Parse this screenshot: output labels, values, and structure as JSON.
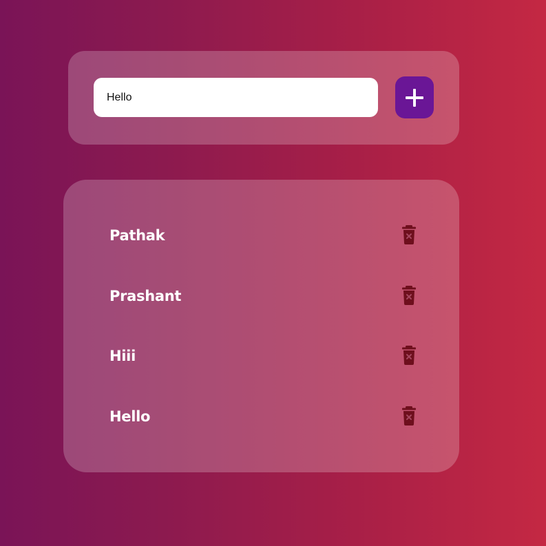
{
  "input": {
    "value": "Hello",
    "add_icon": "plus-icon"
  },
  "todos": [
    {
      "label": "Pathak",
      "delete_icon": "trash-icon"
    },
    {
      "label": "Prashant",
      "delete_icon": "trash-icon"
    },
    {
      "label": "Hiii",
      "delete_icon": "trash-icon"
    },
    {
      "label": "Hello",
      "delete_icon": "trash-icon"
    }
  ],
  "colors": {
    "background_start": "#7a1457",
    "background_end": "#c42843",
    "add_button": "#6a1696",
    "delete_icon": "#6e0f1d"
  }
}
